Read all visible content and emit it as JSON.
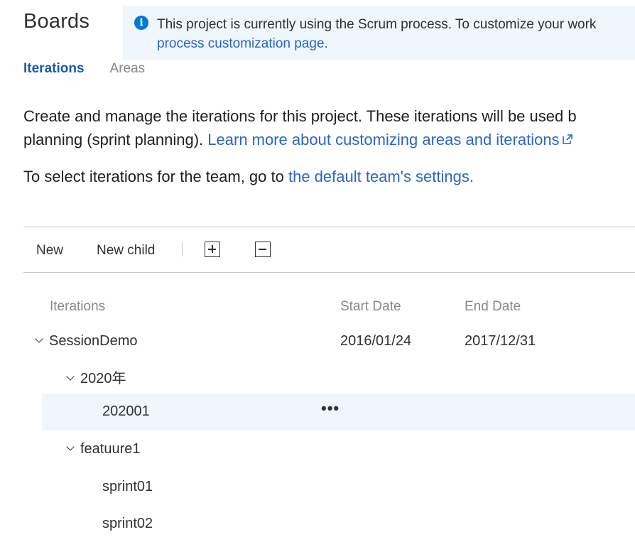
{
  "page": {
    "title": "Boards"
  },
  "banner": {
    "text": "This project is currently using the Scrum process. To customize your work",
    "link": "process customization page."
  },
  "pivot": {
    "tabs": [
      "Iterations",
      "Areas"
    ],
    "active": "Iterations"
  },
  "description": {
    "line1": "Create and manage the iterations for this project. These iterations will be used b",
    "line2_prefix": "planning (sprint planning). ",
    "line2_link": "Learn more about customizing areas and iterations"
  },
  "team_line": {
    "prefix": "To select iterations for the team, go to ",
    "link": "the default team's settings."
  },
  "toolbar": {
    "new_label": "New",
    "new_child_label": "New child"
  },
  "grid": {
    "columns": [
      "Iterations",
      "Start Date",
      "End Date"
    ],
    "rows": [
      {
        "name": "SessionDemo",
        "start": "2016/01/24",
        "end": "2017/12/31",
        "expanded": true,
        "level": 0
      },
      {
        "name": "2020年",
        "start": "",
        "end": "",
        "expanded": true,
        "level": 1
      },
      {
        "name": "202001",
        "start": "",
        "end": "",
        "selected": true,
        "level": 2
      },
      {
        "name": "featuure1",
        "start": "",
        "end": "",
        "expanded": true,
        "level": 1
      },
      {
        "name": "sprint01",
        "start": "",
        "end": "",
        "level": 2
      },
      {
        "name": "sprint02",
        "start": "",
        "end": "",
        "level": 2
      }
    ]
  },
  "colors": {
    "link": "#2b65c6",
    "accent": "#0078d4",
    "banner_bg": "#eff6fc",
    "selected_row_bg": "#eff6fc"
  }
}
